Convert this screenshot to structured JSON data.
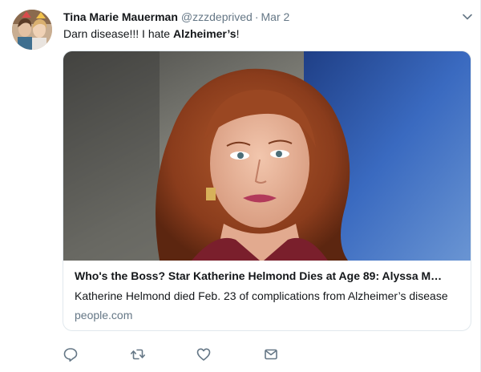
{
  "tweet": {
    "author_name": "Tina Marie Mauerman",
    "handle": "@zzzdeprived",
    "separator": "·",
    "date": "Mar 2",
    "text_prefix": "Darn disease!!! I hate ",
    "text_bold": "Alzheimer’s",
    "text_suffix": "!"
  },
  "card": {
    "title": "Who's the Boss? Star Katherine Helmond Dies at Age 89: Alyssa M…",
    "description": "Katherine Helmond died Feb. 23 of complications from Alzheimer’s disease",
    "domain": "people.com"
  },
  "actions": {
    "reply_icon": "reply-icon",
    "retweet_icon": "retweet-icon",
    "like_icon": "heart-icon",
    "dm_icon": "envelope-icon"
  },
  "colors": {
    "text": "#14171a",
    "muted": "#657786",
    "border": "#e1e8ed",
    "icon": "#657786"
  }
}
